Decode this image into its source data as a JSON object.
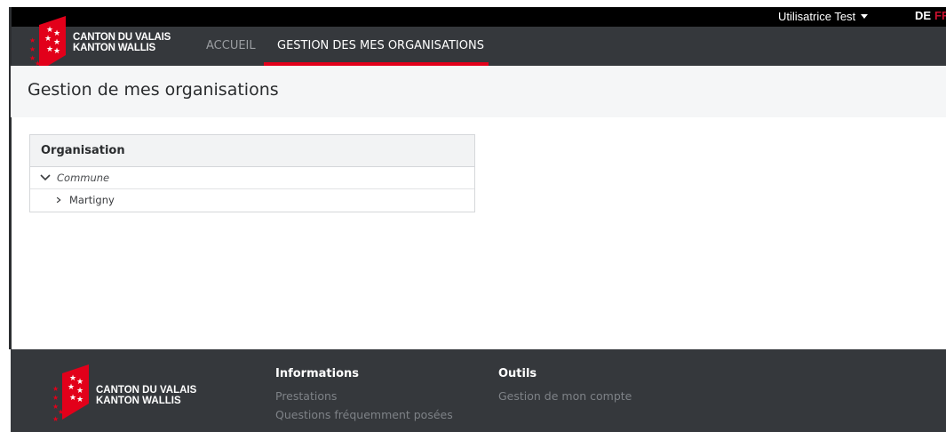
{
  "header": {
    "logo_line1": "CANTON DU VALAIS",
    "logo_line2": "KANTON WALLIS",
    "user_name": "Utilisatrice Test",
    "languages": [
      "DE",
      "FR"
    ],
    "nav": [
      {
        "label": "ACCUEIL",
        "active": false
      },
      {
        "label": "GESTION DES MES ORGANISATIONS",
        "active": true
      }
    ]
  },
  "page": {
    "title": "Gestion de mes organisations"
  },
  "org_table": {
    "header": "Organisation",
    "rows": [
      {
        "label": "Commune",
        "expanded": true,
        "level": 0
      },
      {
        "label": "Martigny",
        "expanded": false,
        "level": 1
      }
    ]
  },
  "footer": {
    "logo_line1": "CANTON DU VALAIS",
    "logo_line2": "KANTON WALLIS",
    "columns": [
      {
        "title": "Informations",
        "links": [
          "Prestations",
          "Questions fréquemment posées"
        ]
      },
      {
        "title": "Outils",
        "links": [
          "Gestion de mon compte"
        ]
      }
    ]
  },
  "colors": {
    "accent": "#e2001a",
    "header_bg": "#35383c",
    "title_band_bg": "#f5f6f7"
  }
}
